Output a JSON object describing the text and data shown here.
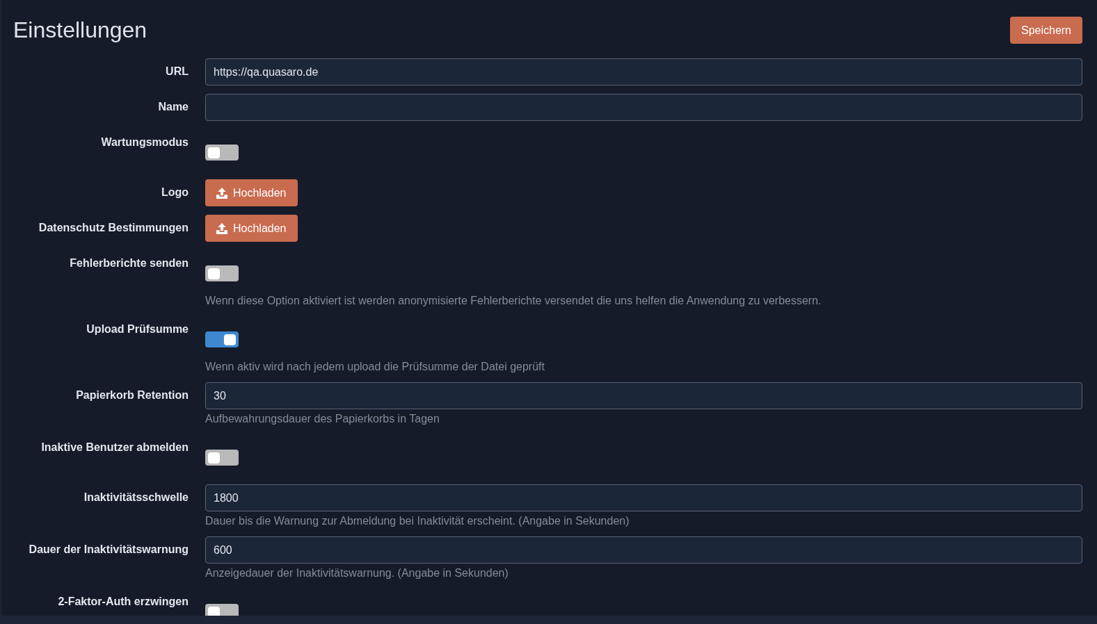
{
  "page": {
    "title": "Einstellungen",
    "save_button": "Speichern"
  },
  "settings": [
    {
      "kind": "text",
      "label": "URL",
      "value": "https://qa.quasaro.de"
    },
    {
      "kind": "text",
      "label": "Name"
    },
    {
      "kind": "toggle",
      "label": "Wartungsmodus",
      "on": false
    },
    {
      "kind": "upload",
      "label": "Logo",
      "button": "Hochladen"
    },
    {
      "kind": "upload",
      "label": "Datenschutz Bestimmungen",
      "button": "Hochladen"
    },
    {
      "kind": "toggle",
      "label": "Fehlerberichte senden",
      "on": false,
      "help": "Wenn diese Option aktiviert ist werden anonymisierte Fehlerberichte versendet die uns helfen die Anwendung zu verbessern."
    },
    {
      "kind": "toggle",
      "label": "Upload Prüfsumme",
      "on": true,
      "help": "Wenn aktiv wird nach jedem upload die Prüfsumme der Datei geprüft"
    },
    {
      "kind": "text",
      "label": "Papierkorb Retention",
      "value": "30",
      "help": "Aufbewahrungsdauer des Papierkorbs in Tagen"
    },
    {
      "kind": "toggle",
      "label": "Inaktive Benutzer abmelden",
      "on": false
    },
    {
      "kind": "text",
      "label": "Inaktivitätsschwelle",
      "value": "1800",
      "help": "Dauer bis die Warnung zur Abmeldung bei Inaktivität erscheint. (Angabe in Sekunden)"
    },
    {
      "kind": "text",
      "label": "Dauer der Inaktivitätswarnung",
      "value": "600",
      "help": "Anzeigedauer der Inaktivitätswarnung. (Angabe in Sekunden)"
    },
    {
      "kind": "toggle",
      "label": "2-Faktor-Auth erzwingen",
      "on": false
    }
  ]
}
